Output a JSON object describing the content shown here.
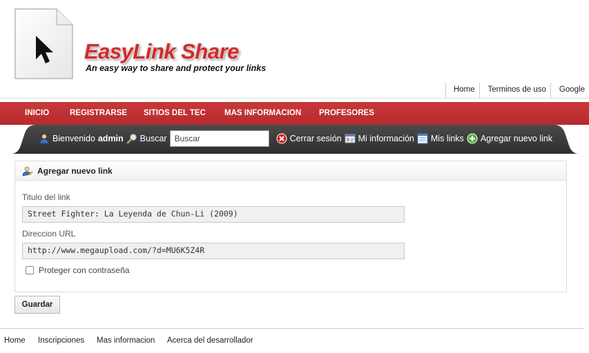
{
  "brand": {
    "name": "EasyLink Share",
    "tagline": "An easy way to share and protect your links"
  },
  "top_links": [
    "Home",
    "Terminos de uso",
    "Google"
  ],
  "nav": [
    "INICIO",
    "REGISTRARSE",
    "SITIOS DEL TEC",
    "MAS INFORMACION",
    "PROFESORES"
  ],
  "userbar": {
    "welcome": "Bienvenido",
    "username": "admin",
    "search_label": "Buscar",
    "search_placeholder": "Buscar",
    "logout": "Cerrar sesión",
    "my_info": "Mi información",
    "my_links": "Mis links",
    "add_link": "Agregar nuevo link"
  },
  "form": {
    "title": "Agregar nuevo link",
    "title_label": "Titulo del link",
    "title_value": "Street Fighter: La Leyenda de Chun-Li (2009)",
    "url_label": "Direccion URL",
    "url_value": "http://www.megaupload.com/?d=MU6K5Z4R",
    "protect_label": "Proteger con contraseña",
    "protect_checked": false,
    "save_label": "Guardar"
  },
  "footer_links": [
    "Home",
    "Inscripciones",
    "Mas informacion",
    "Acerca del desarrollador"
  ],
  "colors": {
    "brand_red": "#d42a2a",
    "nav_red": "#c53032",
    "dark_bar": "#3a3a3a"
  },
  "icons": {
    "page": "cursor-document-icon",
    "user": "user-icon",
    "search": "magnifier-icon",
    "logout": "close-circle-icon",
    "info": "info-card-icon",
    "links": "list-icon",
    "add": "plus-circle-icon",
    "form": "user-edit-icon"
  }
}
